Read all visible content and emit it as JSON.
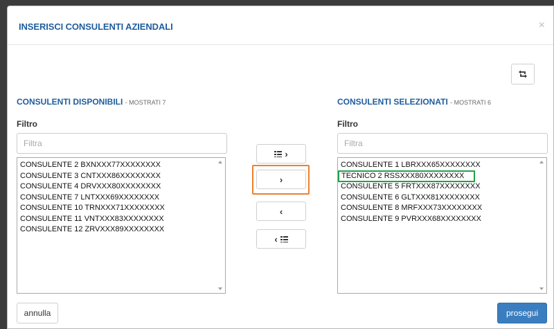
{
  "dialog": {
    "title": "INSERISCI CONSULENTI AZIENDALI",
    "close_glyph": "×"
  },
  "left_panel": {
    "title": "CONSULENTI DISPONIBILI",
    "count_text": "- MOSTRATI 7",
    "filter_label": "Filtro",
    "filter_placeholder": "Filtra",
    "filter_value": "",
    "items": [
      "CONSULENTE 2  BXNXXX77XXXXXXXX",
      "CONSULENTE 3  CNTXXX86XXXXXXXX",
      "CONSULENTE 4  DRVXXX80XXXXXXXX",
      "CONSULENTE 7  LNTXXX69XXXXXXXX",
      "CONSULENTE 10  TRNXXX71XXXXXXXX",
      "CONSULENTE 11  VNTXXX83XXXXXXXX",
      "CONSULENTE 12  ZRVXXX89XXXXXXXX"
    ]
  },
  "right_panel": {
    "title": "CONSULENTI SELEZIONATI",
    "count_text": "- MOSTRATI 6",
    "filter_label": "Filtro",
    "filter_placeholder": "Filtra",
    "filter_value": "",
    "items": [
      "CONSULENTE 1  LBRXXX65XXXXXXXX",
      "TECNICO 2  RSSXXX80XXXXXXXX",
      "CONSULENTE 5  FRTXXX87XXXXXXXX",
      "CONSULENTE 6  GLTXXX81XXXXXXXX",
      "CONSULENTE 8  MRFXXX73XXXXXXXX",
      "CONSULENTE 9  PVRXXX68XXXXXXXX"
    ],
    "highlighted_index": 1
  },
  "transfer_buttons": {
    "move_all_right_glyph": "›",
    "move_selected_right_glyph": "›",
    "move_selected_left_glyph": "‹",
    "move_all_left_glyph": "‹"
  },
  "reset_icon": "refresh-icon",
  "footer": {
    "cancel_label": "annulla",
    "continue_label": "prosegui"
  },
  "colors": {
    "title_blue": "#1f5d9c",
    "primary_button": "#3a7ec0",
    "focus_outline": "#ef7f2d",
    "selection_outline": "#20a24a"
  }
}
